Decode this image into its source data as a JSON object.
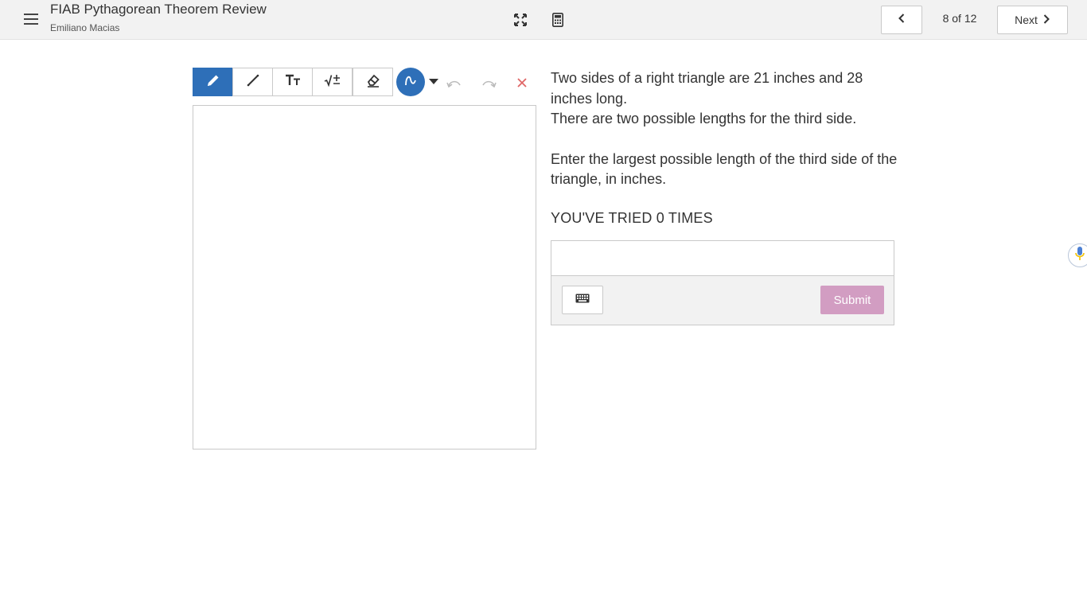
{
  "header": {
    "title": "FIAB Pythagorean Theorem Review",
    "student_name": "Emiliano Macias",
    "page_indicator": "8 of 12",
    "next_label": "Next"
  },
  "icons": {
    "menu": "hamburger-menu-icon",
    "fullscreen": "fullscreen-icon",
    "calculator": "calculator-icon",
    "prev": "chevron-left-icon",
    "next": "chevron-right-icon",
    "pen": "pencil-icon",
    "line": "line-icon",
    "text": "text-icon",
    "math": "math-input-icon",
    "eraser": "eraser-icon",
    "curve": "curve-stroke-icon",
    "dropdown": "caret-down-icon",
    "undo": "undo-icon",
    "redo": "redo-icon",
    "clear": "close-icon",
    "keyboard": "keyboard-icon",
    "mic": "microphone-icon"
  },
  "question": {
    "line1": "Two sides of a right triangle are 21 inches and 28 inches long.",
    "line2": "There are two possible lengths for the third side.",
    "line3": "Enter the largest possible length of the third side of the triangle, in inches.",
    "tries_text": "YOU'VE TRIED 0 TIMES"
  },
  "answer": {
    "value": "",
    "submit_label": "Submit"
  },
  "colors": {
    "accent": "#2e6fb8",
    "submit_disabled": "#d29dc2",
    "clear_red": "#e06666",
    "topbar_bg": "#f2f2f2"
  }
}
